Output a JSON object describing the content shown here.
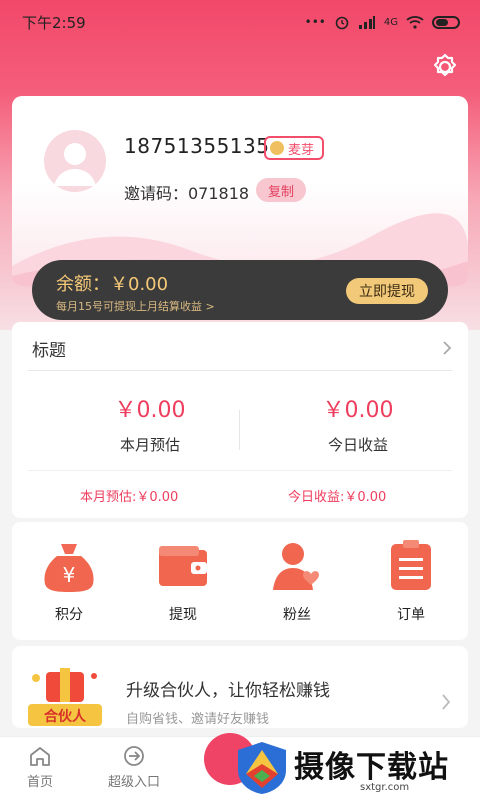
{
  "status_bar": {
    "time": "下午2:59",
    "dots": "•••",
    "signal_label": "4G"
  },
  "profile": {
    "phone": "18751355135",
    "member_level": "麦芽",
    "invite_label": "邀请码：071818",
    "copy_button": "复制"
  },
  "balance": {
    "amount": "余额：￥0.00",
    "note": "每月15号可提现上月结算收益 >",
    "withdraw_button": "立即提现"
  },
  "stats": {
    "title": "标题",
    "month_estimate_value": "￥0.00",
    "month_estimate_label": "本月预估",
    "today_income_value": "￥0.00",
    "today_income_label": "今日收益",
    "month_estimate_line": "本月预估:￥0.00",
    "today_income_line": "今日收益:￥0.00"
  },
  "features": [
    {
      "label": "积分",
      "icon": "money-bag-icon"
    },
    {
      "label": "提现",
      "icon": "wallet-icon"
    },
    {
      "label": "粉丝",
      "icon": "fans-icon"
    },
    {
      "label": "订单",
      "icon": "order-icon"
    }
  ],
  "promo": {
    "title": "升级合伙人，让你轻松赚钱",
    "subtitle": "自购省钱、邀请好友赚钱",
    "image_text": "合伙人"
  },
  "tabbar": [
    {
      "label": "首页",
      "icon": "home-icon"
    },
    {
      "label": "超级入口",
      "icon": "entry-icon"
    }
  ],
  "watermark": {
    "text": "摄像下载站",
    "domain": "sxtgr.com"
  },
  "colors": {
    "primary": "#f2486a",
    "accent_gold": "#f2c979",
    "dark": "#3b3b3b"
  }
}
